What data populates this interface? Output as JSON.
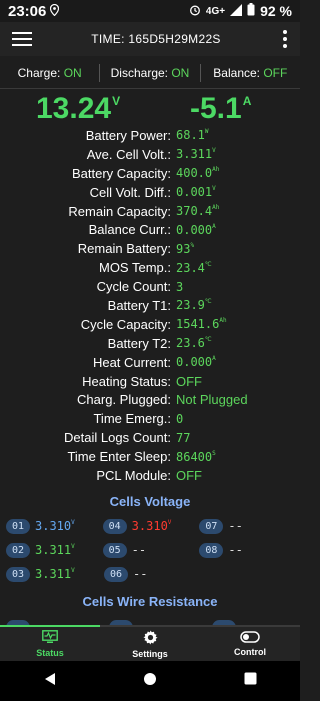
{
  "status_bar": {
    "time": "23:06",
    "network": "4G+",
    "battery": "92 %"
  },
  "app_bar": {
    "title": "TIME: 165D5H29M22S"
  },
  "switches": [
    {
      "label": "Charge:",
      "state": "ON"
    },
    {
      "label": "Discharge:",
      "state": "ON"
    },
    {
      "label": "Balance:",
      "state": "OFF"
    }
  ],
  "summary": {
    "voltage": "13.24",
    "voltage_unit": "V",
    "current": "-5.1",
    "current_unit": "A"
  },
  "params": [
    {
      "label": "Battery Power:",
      "value": "68.1",
      "unit": "W"
    },
    {
      "label": "Ave. Cell Volt.:",
      "value": "3.311",
      "unit": "V"
    },
    {
      "label": "Battery Capacity:",
      "value": "400.0",
      "unit": "Ah"
    },
    {
      "label": "Cell Volt. Diff.:",
      "value": "0.001",
      "unit": "V"
    },
    {
      "label": "Remain Capacity:",
      "value": "370.4",
      "unit": "Ah"
    },
    {
      "label": "Balance Curr.:",
      "value": "0.000",
      "unit": "A"
    },
    {
      "label": "Remain Battery:",
      "value": "93",
      "unit": "%"
    },
    {
      "label": "MOS Temp.:",
      "value": "23.4",
      "unit": "℃"
    },
    {
      "label": "Cycle Count:",
      "value": "3",
      "unit": ""
    },
    {
      "label": "Battery T1:",
      "value": "23.9",
      "unit": "℃"
    },
    {
      "label": "Cycle Capacity:",
      "value": "1541.6",
      "unit": "Ah"
    },
    {
      "label": "Battery T2:",
      "value": "23.6",
      "unit": "℃"
    },
    {
      "label": "Heat Current:",
      "value": "0.000",
      "unit": "A"
    },
    {
      "label": "Heating Status:",
      "value": "OFF",
      "unit": ""
    },
    {
      "label": "Charg. Plugged:",
      "value": "Not Plugged",
      "unit": ""
    },
    {
      "label": "Time Emerg.:",
      "value": "0",
      "unit": ""
    },
    {
      "label": "Detail Logs Count:",
      "value": "77",
      "unit": ""
    },
    {
      "label": "Time Enter Sleep:",
      "value": "86400",
      "unit": "S"
    },
    {
      "label": "PCL Module:",
      "value": "OFF",
      "unit": ""
    }
  ],
  "cells_voltage_title": "Cells Voltage",
  "cells": [
    [
      {
        "id": "01",
        "value": "3.310",
        "unit": "V",
        "color": "#64a8f0"
      },
      {
        "id": "04",
        "value": "3.310",
        "unit": "V",
        "color": "#ff3b30"
      },
      {
        "id": "07",
        "value": "--",
        "unit": "",
        "color": "#dddddd"
      }
    ],
    [
      {
        "id": "02",
        "value": "3.311",
        "unit": "V",
        "color": "#5cd65c"
      },
      {
        "id": "05",
        "value": "--",
        "unit": "",
        "color": "#dddddd"
      },
      {
        "id": "08",
        "value": "--",
        "unit": "",
        "color": "#dddddd"
      }
    ],
    [
      {
        "id": "03",
        "value": "3.311",
        "unit": "V",
        "color": "#5cd65c"
      },
      {
        "id": "06",
        "value": "--",
        "unit": "",
        "color": "#dddddd"
      }
    ]
  ],
  "cells_resistance_title": "Cells Wire Resistance",
  "bottom_nav": [
    {
      "label": "Status",
      "icon": "monitor-icon",
      "active": true
    },
    {
      "label": "Settings",
      "icon": "gear-icon",
      "active": false
    },
    {
      "label": "Control",
      "icon": "toggle-icon",
      "active": false
    }
  ],
  "colors": {
    "accent": "#4cd964",
    "section": "#8ab4f8"
  }
}
